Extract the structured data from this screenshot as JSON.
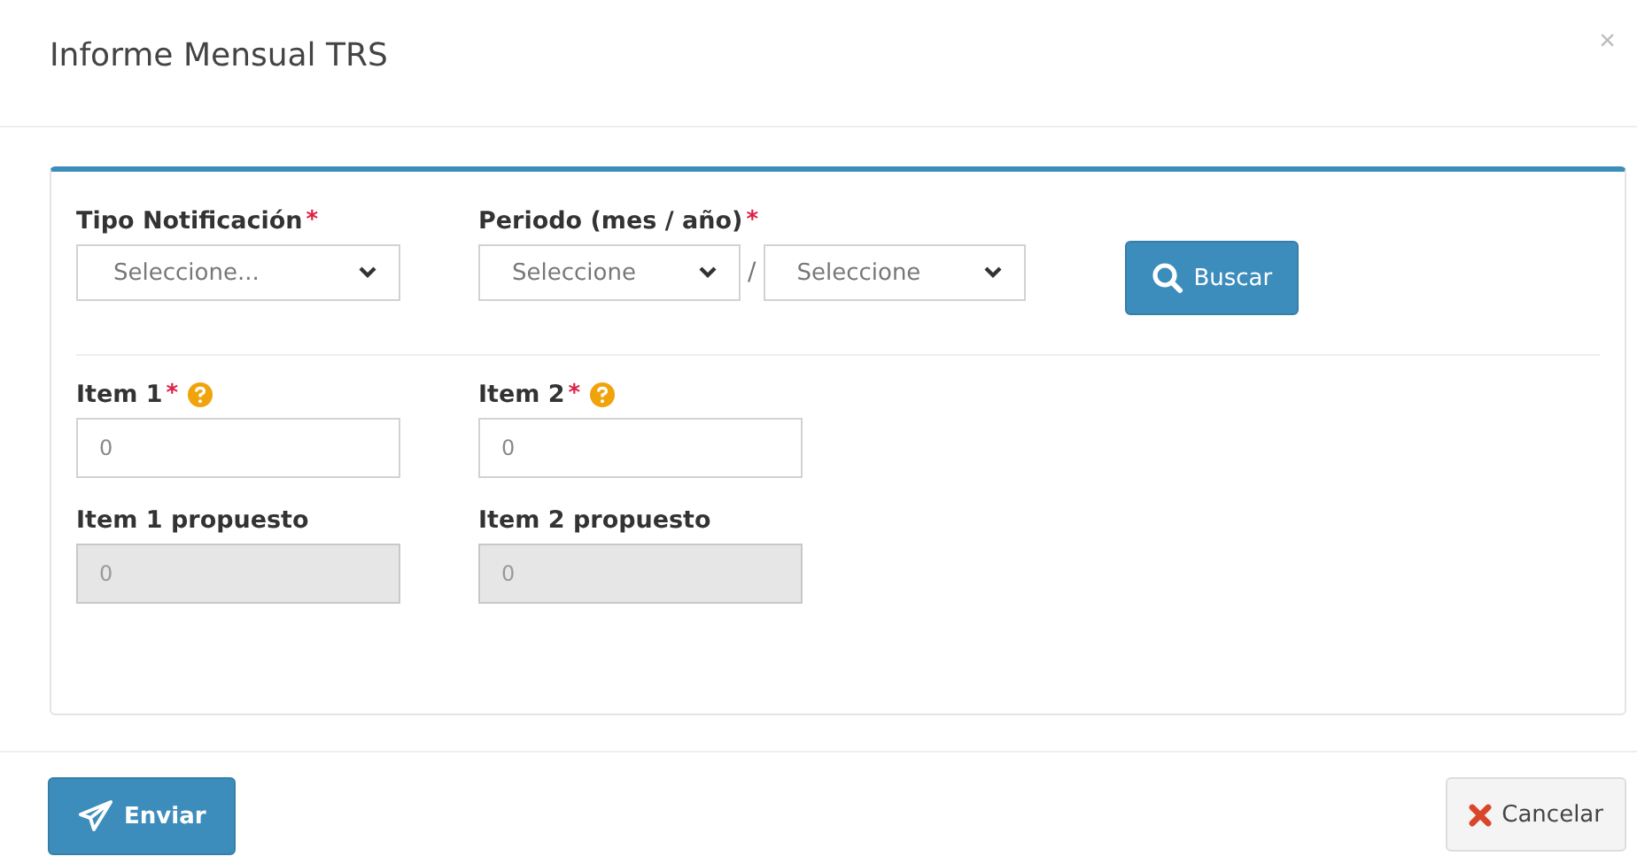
{
  "window": {
    "title": "Informe Mensual TRS",
    "close": "×"
  },
  "filters": [
    {
      "label": "Tipo Notificación",
      "required_mark": "*",
      "selects": [
        {
          "value": "Seleccione..."
        }
      ]
    },
    {
      "label": "Periodo (mes / año)",
      "required_mark": "*",
      "separator": "/",
      "selects": [
        {
          "value": "Seleccione"
        },
        {
          "value": "Seleccione"
        }
      ]
    }
  ],
  "search_button": {
    "label": "Buscar"
  },
  "fields": [
    {
      "label": "Item 1",
      "required_mark": "*",
      "help": true,
      "value": "0",
      "disabled": false
    },
    {
      "label": "Item 2",
      "required_mark": "*",
      "help": true,
      "value": "0",
      "disabled": false
    },
    {
      "label": "Item 1 propuesto",
      "help": false,
      "value": "0",
      "disabled": true
    },
    {
      "label": "Item 2 propuesto",
      "help": false,
      "value": "0",
      "disabled": true
    }
  ],
  "footer": {
    "send": "Enviar",
    "cancel": "Cancelar"
  }
}
